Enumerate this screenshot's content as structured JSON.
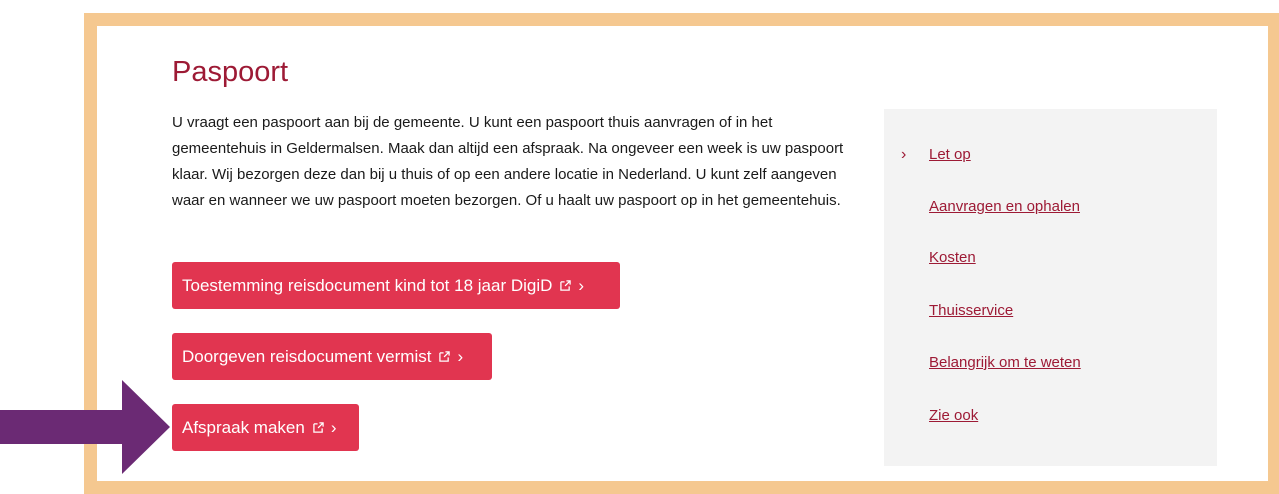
{
  "page": {
    "title": "Paspoort",
    "intro": "U vraagt een paspoort aan bij de gemeente. U kunt een paspoort thuis aanvragen of in het gemeentehuis in Geldermalsen. Maak dan altijd een afspraak. Na ongeveer een week is uw paspoort klaar. Wij bezorgen deze dan bij u thuis of op een andere locatie in Nederland. U kunt zelf aangeven waar en wanneer we uw paspoort moeten bezorgen. Of u haalt uw paspoort op in het gemeentehuis."
  },
  "buttons": [
    {
      "label": "Toestemming reisdocument kind tot 18 jaar DigiD",
      "icon": "external-link-icon",
      "chevron": "›"
    },
    {
      "label": "Doorgeven reisdocument vermist",
      "icon": "external-link-icon",
      "chevron": "›"
    },
    {
      "label": "Afspraak maken",
      "icon": "external-link-icon",
      "chevron": "›"
    }
  ],
  "sidebar": {
    "active_marker": "›",
    "items": [
      {
        "label": "Let op"
      },
      {
        "label": "Aanvragen en ophalen"
      },
      {
        "label": "Kosten"
      },
      {
        "label": "Thuisservice"
      },
      {
        "label": "Belangrijk om te weten"
      },
      {
        "label": "Zie ook"
      }
    ]
  },
  "colors": {
    "frame": "#f5c890",
    "title": "#9d1a35",
    "button": "#e13550",
    "sidebar_bg": "#f3f3f3",
    "arrow": "#6b2a74"
  }
}
